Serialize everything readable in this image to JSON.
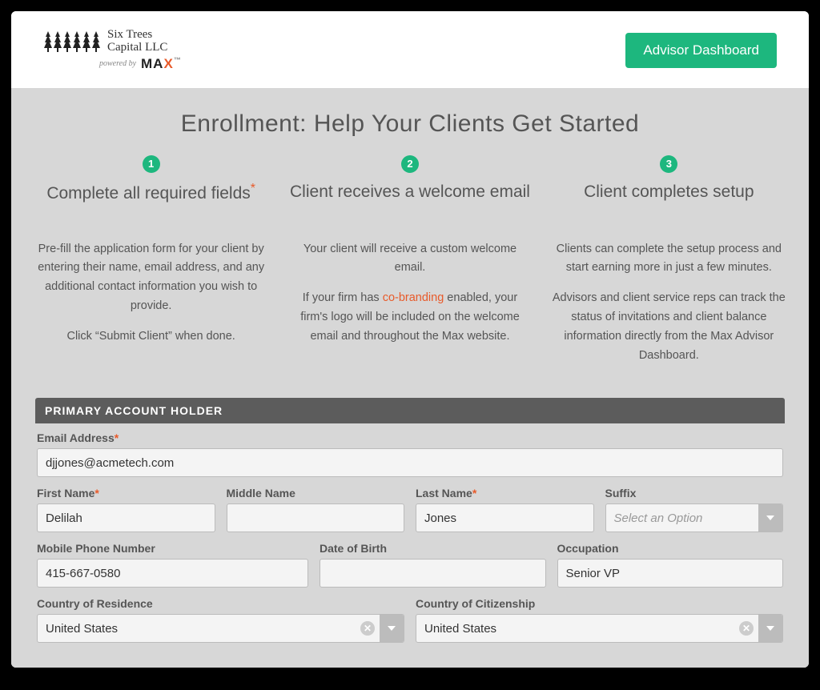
{
  "header": {
    "logo_line1": "Six Trees",
    "logo_line2": "Capital LLC",
    "powered_by": "powered by",
    "max_brand": "MAX",
    "dashboard_btn": "Advisor Dashboard"
  },
  "page_title": "Enrollment: Help Your Clients Get Started",
  "steps": [
    {
      "num": "1",
      "title": "Complete all required fields",
      "has_star": true,
      "para1": "Pre-fill the application form for your client by entering their name, email address, and any additional contact information you wish to provide.",
      "para2": "Click “Submit Client” when done."
    },
    {
      "num": "2",
      "title": "Client receives a welcome email",
      "para1": "Your client will receive a custom welcome email.",
      "para2_pre": "If your firm has ",
      "para2_link": "co-branding",
      "para2_post": " enabled, your firm's logo will be included on the welcome email and throughout the Max website."
    },
    {
      "num": "3",
      "title": "Client completes setup",
      "para1": "Clients can complete the setup process and start earning more in just a few minutes.",
      "para2": "Advisors and client service reps can track the status of invitations and client balance information directly from the Max Advisor Dashboard."
    }
  ],
  "form": {
    "section_title": "PRIMARY ACCOUNT HOLDER",
    "email_label": "Email Address",
    "email_value": "djjones@acmetech.com",
    "first_label": "First Name",
    "first_value": "Delilah",
    "middle_label": "Middle Name",
    "middle_value": "",
    "last_label": "Last Name",
    "last_value": "Jones",
    "suffix_label": "Suffix",
    "suffix_placeholder": "Select an Option",
    "mobile_label": "Mobile Phone Number",
    "mobile_value": "415-667-0580",
    "dob_label": "Date of Birth",
    "dob_value": "",
    "occupation_label": "Occupation",
    "occupation_value": "Senior VP",
    "residence_label": "Country of Residence",
    "residence_value": "United States",
    "citizenship_label": "Country of Citizenship",
    "citizenship_value": "United States"
  }
}
